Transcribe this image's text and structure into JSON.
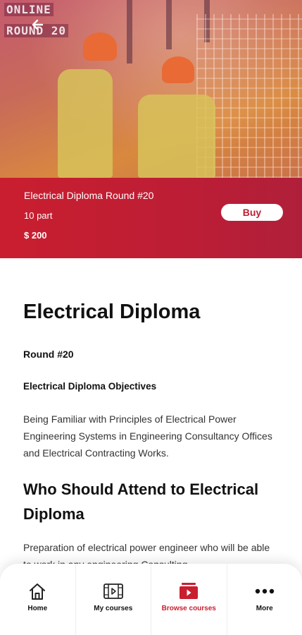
{
  "hero": {
    "badge_line1": "ONLINE",
    "badge_line2": "ROUND 20"
  },
  "course": {
    "title": "Electrical Diploma Round #20",
    "parts": "10 part",
    "price": "$ 200",
    "buy_label": "Buy"
  },
  "content": {
    "heading": "Electrical Diploma",
    "round": "Round #20",
    "objectives_title": "Electrical Diploma Objectives",
    "objectives_text": "Being Familiar with Principles of Electrical Power Engineering Systems in Engineering Consultancy Offices and Electrical Contracting Works.",
    "attend_heading": "Who Should Attend to Electrical Diploma",
    "attend_text": "Preparation of electrical power engineer who will be able to work in any engineering Consulting"
  },
  "nav": {
    "items": [
      {
        "label": "Home",
        "icon": "home-icon",
        "active": false
      },
      {
        "label": "My courses",
        "icon": "video-frame-icon",
        "active": false
      },
      {
        "label": "Browse courses",
        "icon": "play-box-icon",
        "active": true
      },
      {
        "label": "More",
        "icon": "more-dots-icon",
        "active": false
      }
    ]
  },
  "colors": {
    "accent": "#c91e2f",
    "band_end": "#b01f3a",
    "text": "#111111"
  }
}
